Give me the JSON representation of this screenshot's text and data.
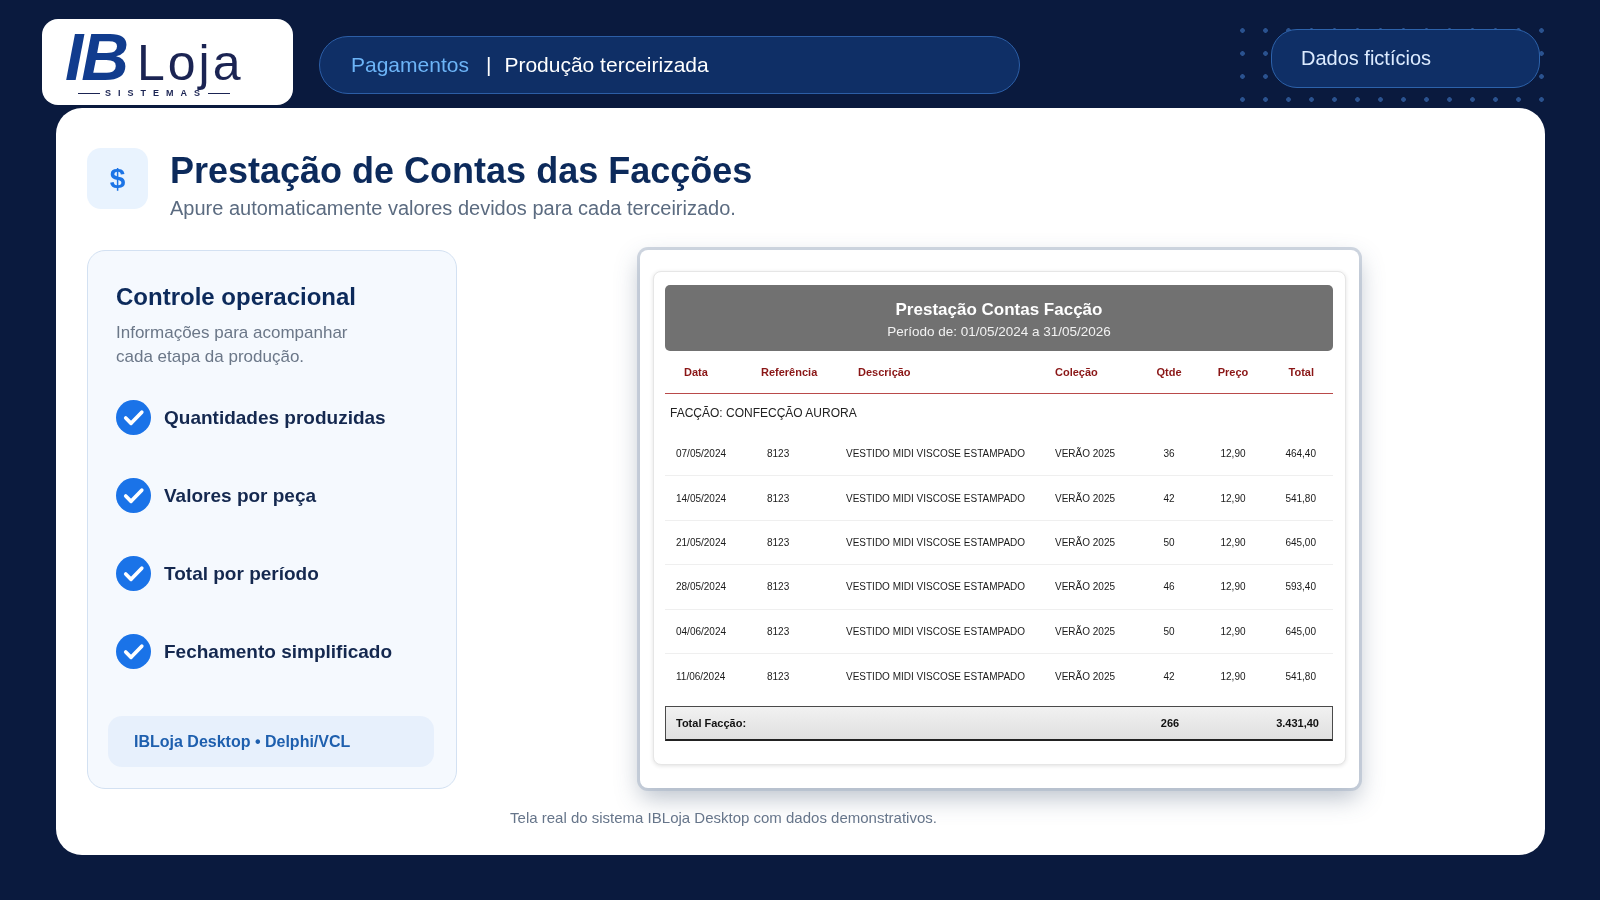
{
  "logo": {
    "mark": "IB",
    "word": "Loja",
    "tagline": "SISTEMAS"
  },
  "breadcrumb": {
    "section": "Pagamentos",
    "separator": "|",
    "page": "Produção terceirizada"
  },
  "badge": {
    "label": "Dados fictícios"
  },
  "header": {
    "icon": "$",
    "title": "Prestação de Contas das Facções",
    "subtitle": "Apure automaticamente valores devidos para cada terceirizado."
  },
  "feature_card": {
    "title": "Controle operacional",
    "description": "Informações para acompanhar cada etapa da produção.",
    "items": [
      {
        "label": "Quantidades produzidas",
        "checked": true
      },
      {
        "label": "Valores por peça",
        "checked": true
      },
      {
        "label": "Total por período",
        "checked": true
      },
      {
        "label": "Fechamento simplificado",
        "checked": true
      }
    ],
    "footer": "IBLoja Desktop • Delphi/VCL"
  },
  "report": {
    "title": "Prestação Contas Facção",
    "period": "Período de: 01/05/2024 a 31/05/2026",
    "columns": [
      "Data",
      "Referência",
      "Descrição",
      "Coleção",
      "Qtde",
      "Preço",
      "Total"
    ],
    "group": "FACÇÃO: CONFECÇÃO AURORA",
    "rows": [
      [
        "07/05/2024",
        "8123",
        "VESTIDO MIDI VISCOSE ESTAMPADO",
        "VERÃO 2025",
        "36",
        "12,90",
        "464,40"
      ],
      [
        "14/05/2024",
        "8123",
        "VESTIDO MIDI VISCOSE ESTAMPADO",
        "VERÃO 2025",
        "42",
        "12,90",
        "541,80"
      ],
      [
        "21/05/2024",
        "8123",
        "VESTIDO MIDI VISCOSE ESTAMPADO",
        "VERÃO 2025",
        "50",
        "12,90",
        "645,00"
      ],
      [
        "28/05/2024",
        "8123",
        "VESTIDO MIDI VISCOSE ESTAMPADO",
        "VERÃO 2025",
        "46",
        "12,90",
        "593,40"
      ],
      [
        "04/06/2024",
        "8123",
        "VESTIDO MIDI VISCOSE ESTAMPADO",
        "VERÃO 2025",
        "50",
        "12,90",
        "645,00"
      ],
      [
        "11/06/2024",
        "8123",
        "VESTIDO MIDI VISCOSE ESTAMPADO",
        "VERÃO 2025",
        "42",
        "12,90",
        "541,80"
      ]
    ],
    "total": {
      "label": "Total Facção:",
      "quantity": "266",
      "amount": "3.431,40"
    }
  },
  "caption": "Tela real do sistema IBLoja Desktop com dados demonstrativos."
}
